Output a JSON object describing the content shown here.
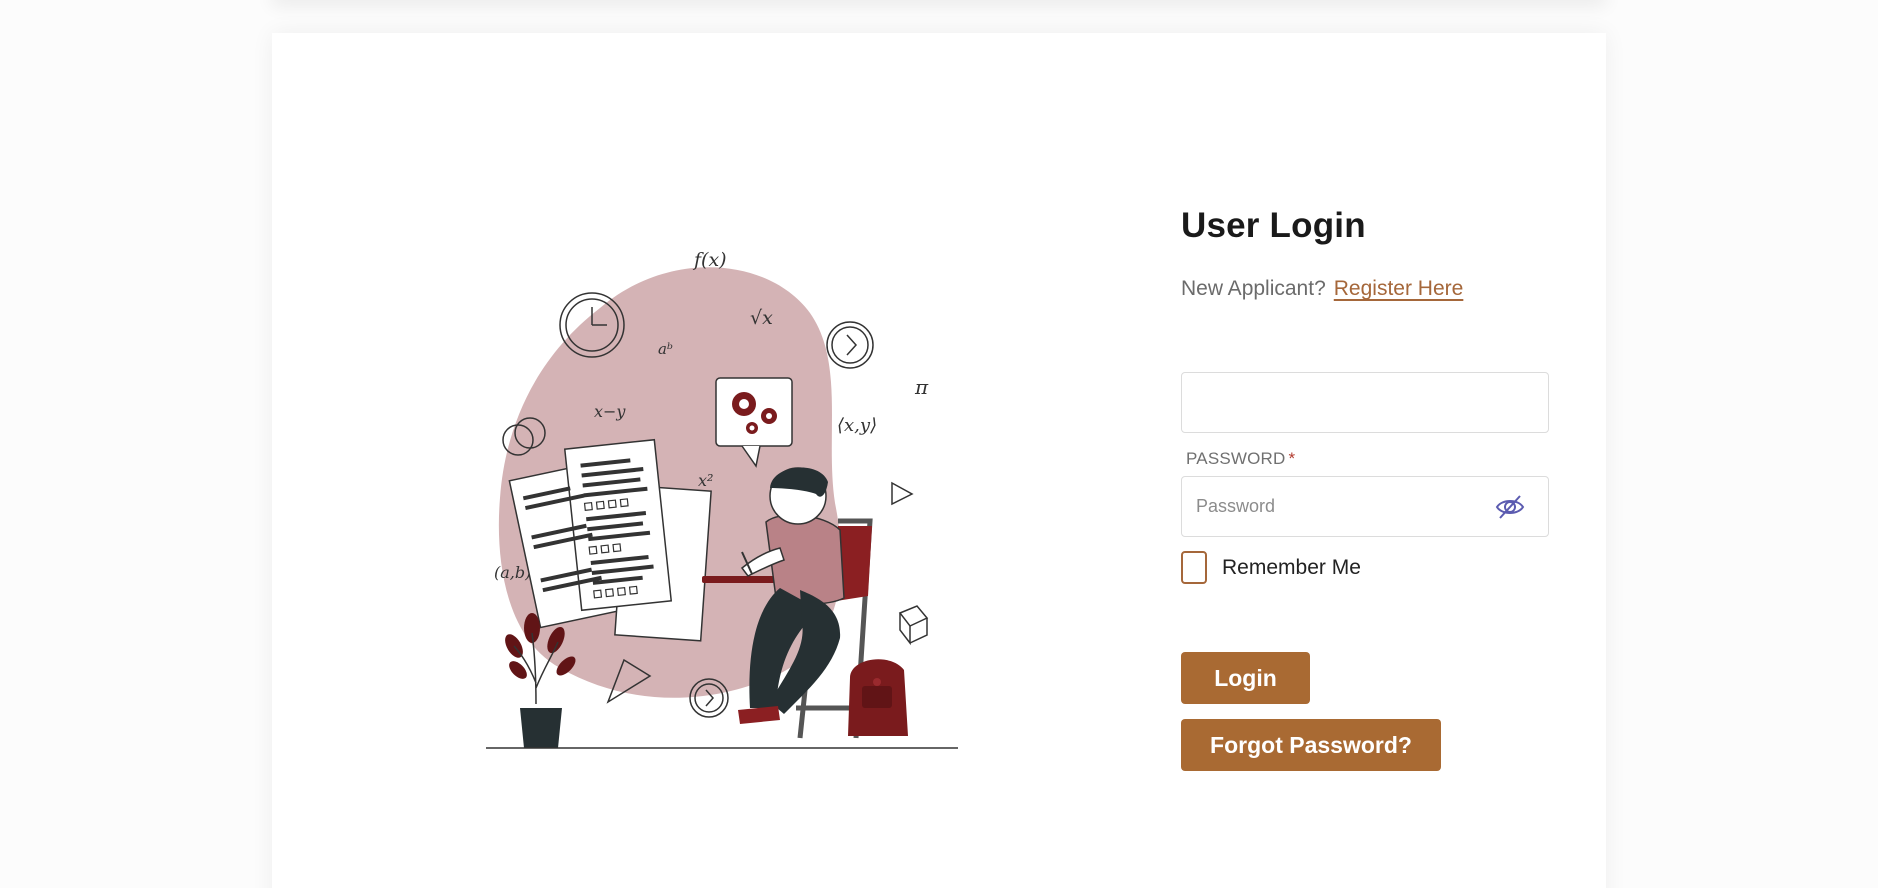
{
  "login": {
    "title": "User Login",
    "new_applicant_text": "New Applicant?",
    "register_link": "Register Here",
    "username_value": "",
    "password_label": "PASSWORD",
    "required_marker": "*",
    "password_placeholder": "Password",
    "remember_label": "Remember Me",
    "remember_checked": false,
    "login_button": "Login",
    "forgot_button": "Forgot Password?"
  },
  "icons": {
    "password_toggle": "eye-slash-icon"
  },
  "colors": {
    "accent": "#a96a33",
    "link": "#a5673a",
    "blob": "#d4b3b5",
    "dark_red": "#7a1b1d",
    "toggle_icon": "#5b5bb0"
  }
}
